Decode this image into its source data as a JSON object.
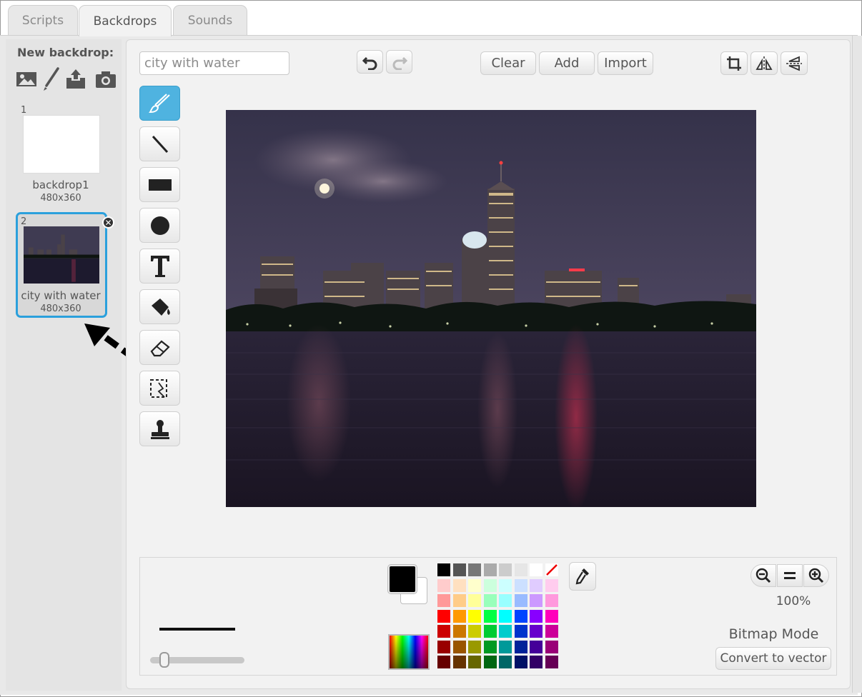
{
  "tabs": [
    {
      "label": "Scripts"
    },
    {
      "label": "Backdrops"
    },
    {
      "label": "Sounds"
    }
  ],
  "sidebar": {
    "new_backdrop_label": "New backdrop:",
    "new_backdrop_icons": [
      "image-library-icon",
      "paint-brush-icon",
      "upload-icon",
      "camera-icon"
    ],
    "backdrops": [
      {
        "number": "1",
        "name": "backdrop1",
        "size": "480x360"
      },
      {
        "number": "2",
        "name": "city with water",
        "size": "480x360"
      }
    ]
  },
  "editor": {
    "name_field_value": "city with water",
    "buttons": {
      "clear": "Clear",
      "add": "Add",
      "import": "Import"
    },
    "tools": [
      "brush-icon",
      "line-icon",
      "rectangle-icon",
      "ellipse-icon",
      "text-icon",
      "fill-icon",
      "eraser-icon",
      "select-icon",
      "stamp-icon"
    ],
    "zoom_level": "100%",
    "mode_label": "Bitmap Mode",
    "convert_button": "Convert to vector",
    "palette_colors": [
      [
        "#000000",
        "#555555",
        "#777777",
        "#aaaaaa",
        "#cccccc",
        "#e6e6e6",
        "#ffffff",
        "none"
      ],
      [
        "#ffcccc",
        "#ffe0c0",
        "#ffffcc",
        "#ccffdd",
        "#ccffff",
        "#cce0ff",
        "#e0ccff",
        "#ffccee"
      ],
      [
        "#ff9999",
        "#ffcc88",
        "#ffff99",
        "#99ffbb",
        "#99ffff",
        "#99bbff",
        "#cc99ff",
        "#ff99dd"
      ],
      [
        "#ff0000",
        "#ff9900",
        "#ffff00",
        "#00ff44",
        "#00ffff",
        "#0044ff",
        "#8800ff",
        "#ff00bb"
      ],
      [
        "#cc0000",
        "#cc7700",
        "#cccc00",
        "#00cc33",
        "#00cccc",
        "#0033cc",
        "#6600cc",
        "#cc0099"
      ],
      [
        "#990000",
        "#995500",
        "#999900",
        "#009922",
        "#009999",
        "#002299",
        "#440099",
        "#990077"
      ],
      [
        "#660000",
        "#663300",
        "#666600",
        "#006611",
        "#006666",
        "#001166",
        "#330066",
        "#660055"
      ]
    ],
    "primary_color": "#000000",
    "secondary_color": "#ffffff"
  }
}
